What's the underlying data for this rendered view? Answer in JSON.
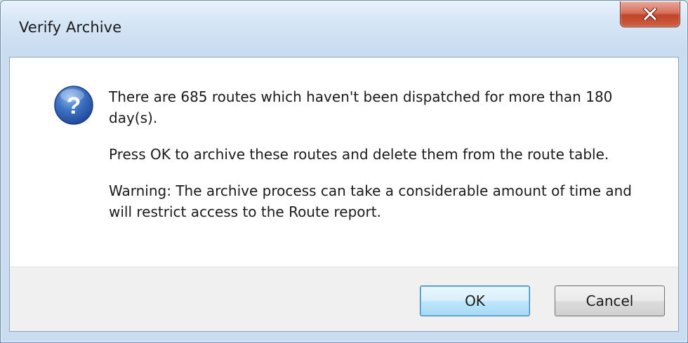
{
  "dialog": {
    "title": "Verify Archive",
    "icon": "question-icon",
    "messages": [
      "There are 685 routes which haven't been dispatched for more than 180 day(s).",
      "Press OK to archive these routes and delete them from the route table.",
      "Warning: The archive process can take a considerable amount of time and will restrict access to the Route report."
    ],
    "buttons": {
      "ok_label": "OK",
      "cancel_label": "Cancel"
    },
    "colors": {
      "close_button": "#c0442b",
      "question_icon": "#2f5fae",
      "ok_focus_border": "#3c7fb1"
    }
  }
}
